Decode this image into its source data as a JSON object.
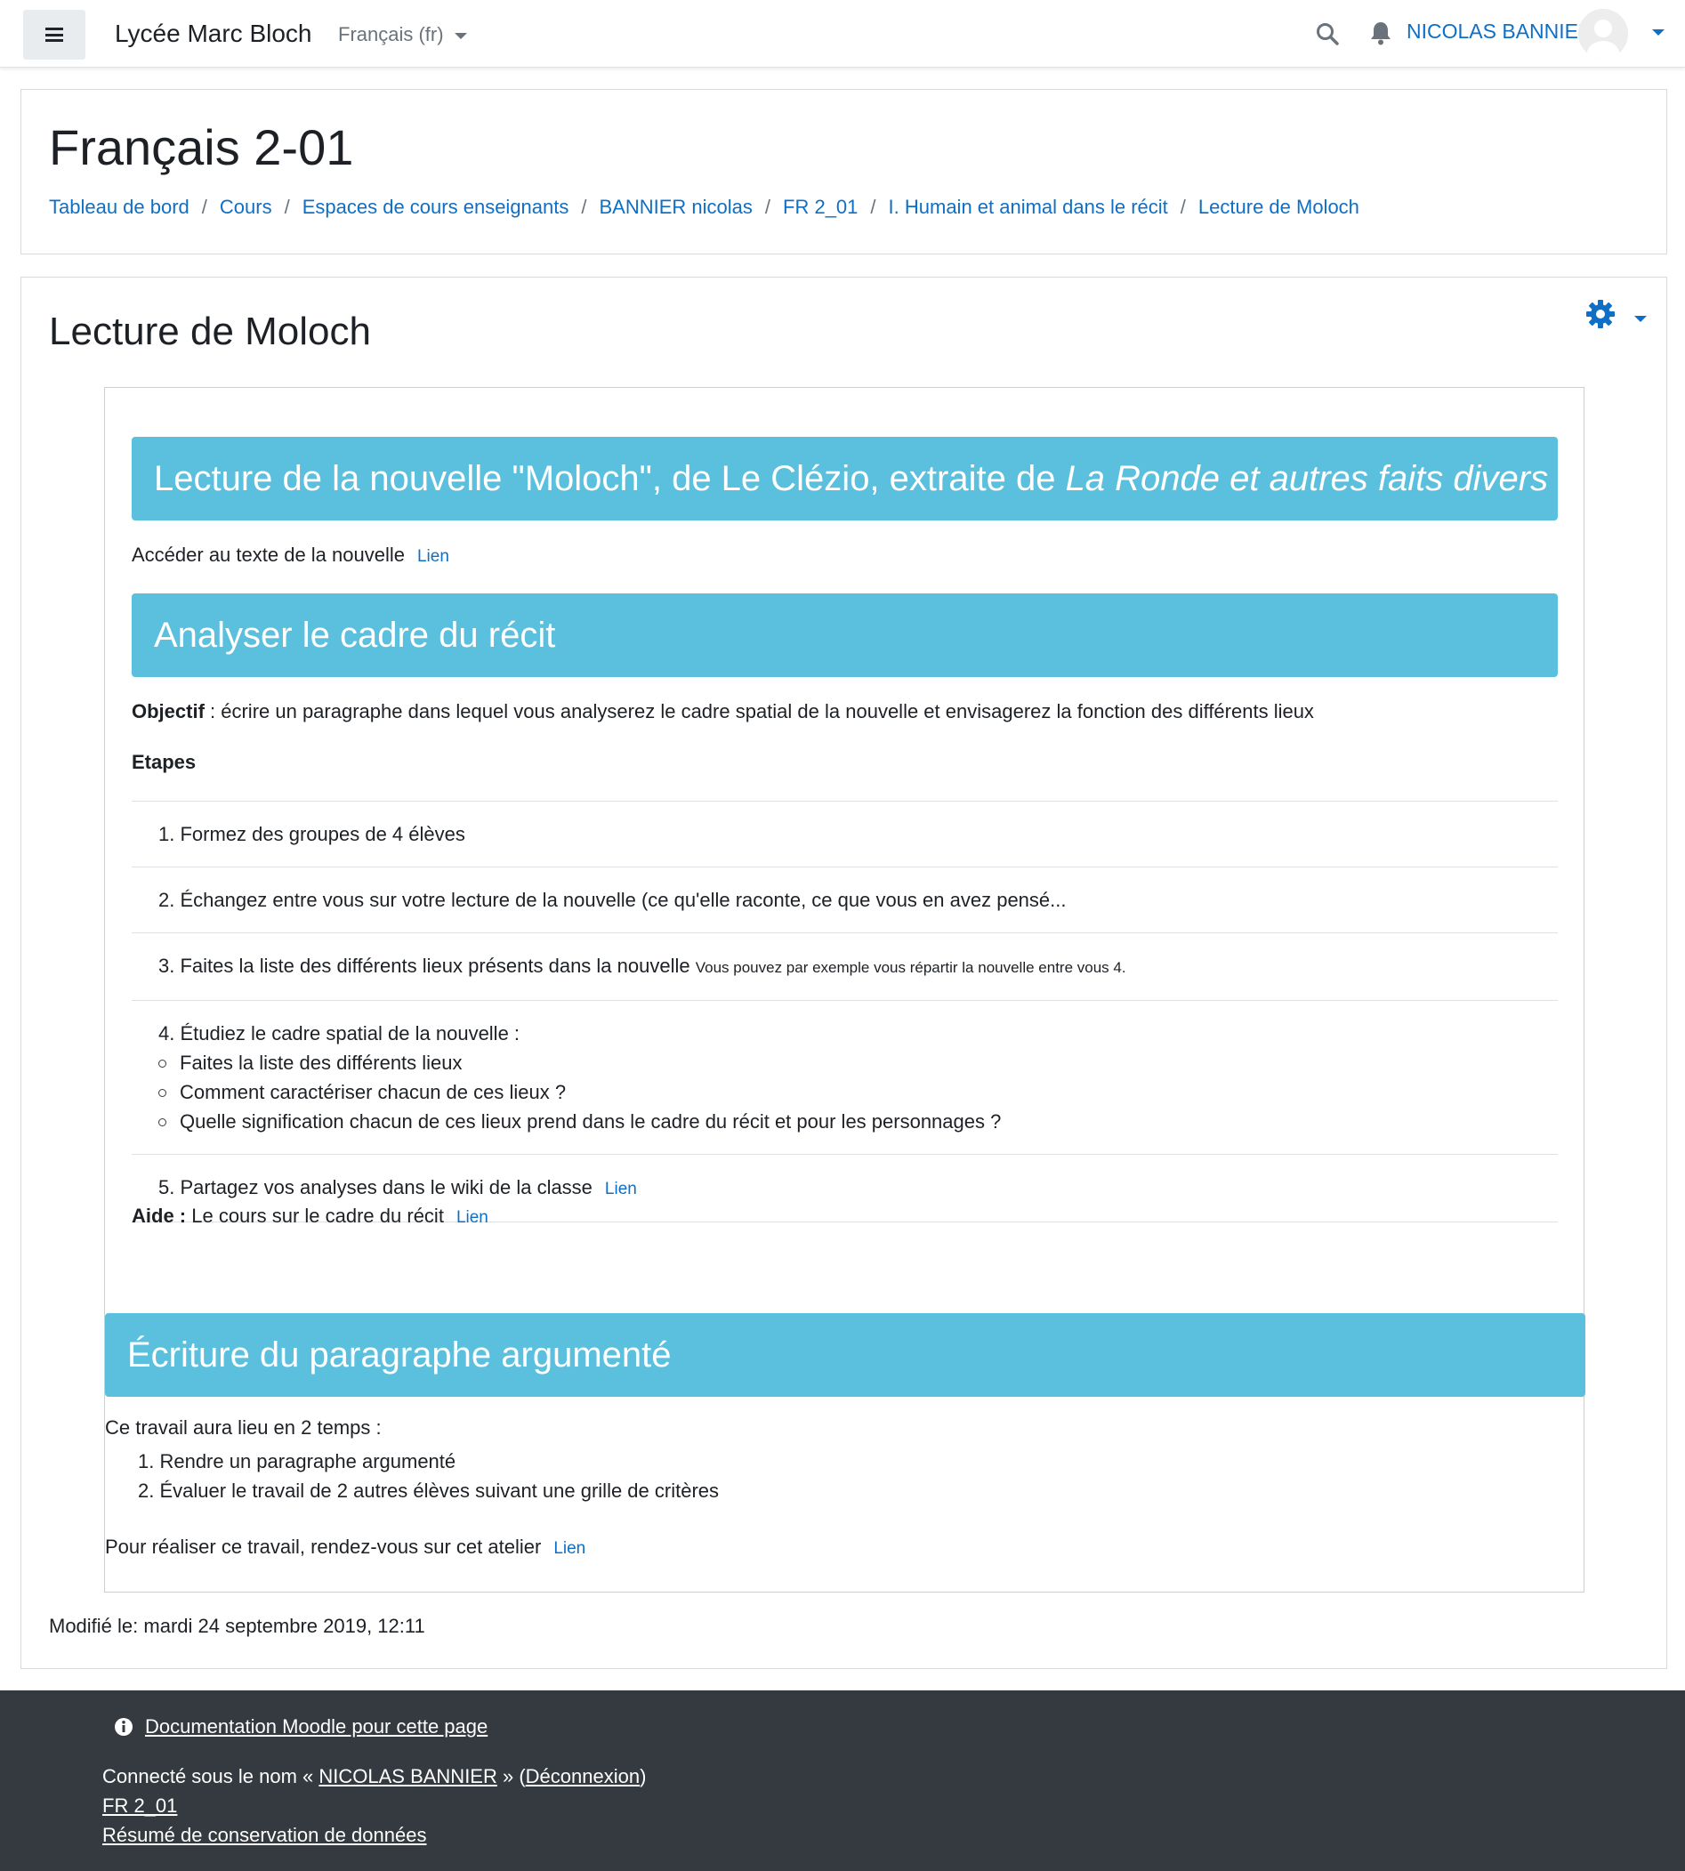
{
  "navbar": {
    "site_name": "Lycée Marc Bloch",
    "language": "Français (fr)",
    "user_name": "NICOLAS BANNIER"
  },
  "header": {
    "course_title": "Français 2-01",
    "breadcrumb": [
      "Tableau de bord",
      "Cours",
      "Espaces de cours enseignants",
      "BANNIER nicolas",
      "FR 2_01",
      "I. Humain et animal dans le récit",
      "Lecture de Moloch"
    ],
    "separator": "/"
  },
  "page": {
    "heading": "Lecture de Moloch",
    "banner1_prefix": "Lecture de la nouvelle \"Moloch\", de Le Clézio, extraite de ",
    "banner1_italic": "La Ronde et autres faits divers",
    "access_text": "Accéder au texte de la nouvelle",
    "link_label": "Lien",
    "banner2": "Analyser le cadre du récit",
    "objectif_label": "Objectif",
    "objectif_text": " : écrire un paragraphe dans lequel vous analyserez le cadre spatial de la nouvelle et envisagerez la fonction des différents lieux",
    "etapes_label": "Etapes",
    "steps": {
      "s1": "1. Formez des groupes de 4 élèves",
      "s2": "2. Échangez entre vous sur votre lecture de la nouvelle (ce qu'elle raconte, ce que vous en avez pensé...",
      "s3": "3. Faites la liste des différents lieux présents dans la nouvelle",
      "s3_note": "Vous pouvez par exemple vous répartir la nouvelle entre vous 4.",
      "s4": "4. Étudiez le cadre spatial de la nouvelle :",
      "s4_sub": [
        "Faites la liste des différents lieux",
        "Comment caractériser chacun de ces lieux ?",
        "Quelle signification chacun de ces lieux prend dans le cadre du récit et pour les personnages ?"
      ],
      "s5": "5. Partagez vos analyses dans le wiki de la classe"
    },
    "aide_label": "Aide :",
    "aide_text": " Le cours sur le cadre du récit",
    "banner3": "Écriture du paragraphe argumenté",
    "travail_text": "Ce travail aura lieu en 2 temps :",
    "travail_items": [
      "1. Rendre un paragraphe argumenté",
      "2. Évaluer le travail de 2 autres élèves suivant une grille de critères"
    ],
    "realiser_text": "Pour réaliser ce travail, rendez-vous sur cet atelier",
    "modified": "Modifié le: mardi 24 septembre 2019, 12:11"
  },
  "footer": {
    "doc_link": "Documentation Moodle pour cette page",
    "connected_prefix": "Connecté sous le nom « ",
    "connected_user": "NICOLAS BANNIER",
    "connected_mid": " » (",
    "logout": "Déconnexion",
    "connected_suffix": ")",
    "course_link": "FR 2_01",
    "data_link": "Résumé de conservation de données"
  },
  "colors": {
    "banner": "#5bc0de",
    "link": "#0f6fc5",
    "footer_bg": "#343a40"
  }
}
